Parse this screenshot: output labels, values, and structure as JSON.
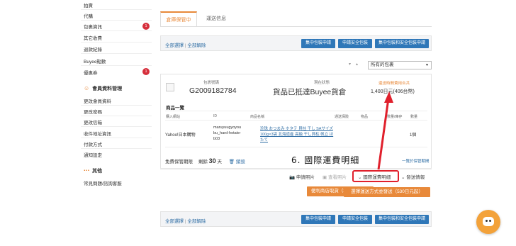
{
  "sidebar": {
    "items_top": [
      {
        "label": "拍賣",
        "badge": null
      },
      {
        "label": "代購",
        "badge": null
      },
      {
        "label": "包裹資訊",
        "badge": "1"
      },
      {
        "label": "其它收費",
        "badge": null
      },
      {
        "label": "退款紀錄",
        "badge": null
      },
      {
        "label": "Buyee點數",
        "badge": null
      },
      {
        "label": "優惠券",
        "badge": "1"
      }
    ],
    "member_heading": "會員資料管理",
    "member_items": [
      "更改會員資料",
      "更改密碼",
      "更改信箱",
      "收件地址資訊",
      "付款方式",
      "通知設定"
    ],
    "other_heading": "其他",
    "other_items": [
      "常見問題/諮詢客服"
    ]
  },
  "tabs": [
    {
      "label": "倉庫保管中",
      "active": true
    },
    {
      "label": "運送信息",
      "active": false
    }
  ],
  "bulk": {
    "select_all": "全部選擇",
    "deselect_all": "全部解除",
    "buttons": [
      "集中包裝申請",
      "申請安全包裝",
      "集中包裝和安全包裝申請"
    ]
  },
  "filter": {
    "selected": "所有的包裹"
  },
  "package": {
    "number_label": "包裹號碼",
    "number": "G2009182784",
    "status_label": "現在狀態",
    "status": "貨品已抵達Buyee貨倉",
    "fee_label": "還送時間費用合共",
    "fee": "1,400日元(406台幣)",
    "items_title": "商品一覽",
    "columns": [
      "購入網站",
      "ID",
      "商品名稱",
      "通送保險",
      "物品",
      "數量/庫存",
      "數量"
    ],
    "row": {
      "site": "Yahoo!日本購物",
      "id_line1": "maruyuugyoyou",
      "id_line2": "bu_hard-hotate-",
      "id_line3": "b03",
      "name_line1": "珍珠 おつまみ ホタテ 貝柱 干し SAサイズ",
      "name_line2": "100g×3袋 北海道産 高級 干し貝柱 帆立 ほ",
      "name_line3": "たて",
      "qty": "1個"
    }
  },
  "storage": {
    "label": "免費保管期限",
    "remain_label": "剩餘",
    "days": "30",
    "unit": "天",
    "return_label": "銷毀",
    "history": "一覽於保管期間"
  },
  "annotation": "6. 國際運費明細",
  "actions": {
    "photo": "申請照片",
    "view_photo": "查看照片",
    "fee_detail": "國際運費明細",
    "shipping_info": "發送情報"
  },
  "buttons": {
    "convenience": "便利商店取貨（240日元起）",
    "choose_shipping": "選擇運送方式並發送（530日元起）"
  }
}
